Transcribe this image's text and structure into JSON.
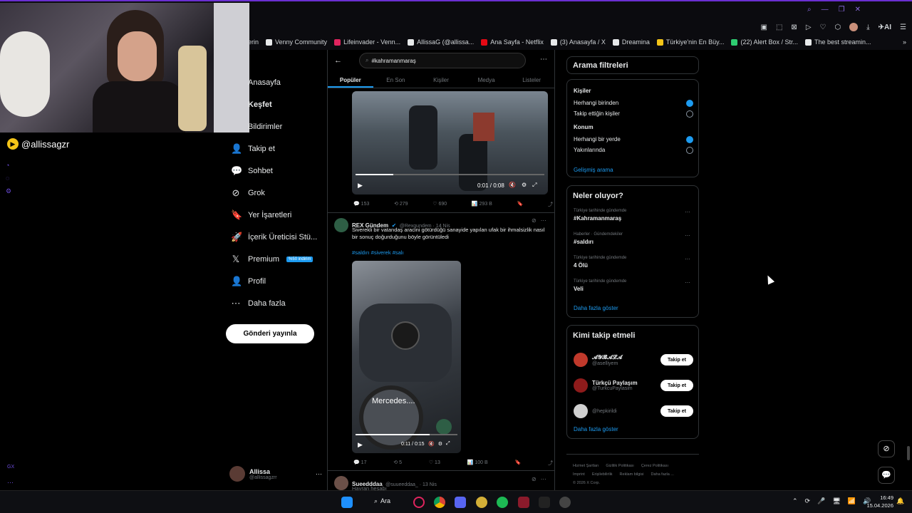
{
  "browser": {
    "bookmarks": [
      {
        "label": "erin",
        "color": ""
      },
      {
        "label": "Venny Community",
        "color": "#e7e9ea"
      },
      {
        "label": "Lifeinvader - Venn...",
        "color": "#e0245e"
      },
      {
        "label": "AllissaG (@allissa...",
        "color": "#e7e9ea"
      },
      {
        "label": "Ana Sayfa - Netflix",
        "color": "#e50914"
      },
      {
        "label": "(3) Anasayfa / X",
        "color": "#e7e9ea"
      },
      {
        "label": "Dreamina",
        "color": "#e7e9ea"
      },
      {
        "label": "Türkiye'nin En Büy...",
        "color": "#f5c518"
      },
      {
        "label": "(22) Alert Box / Str...",
        "color": "#2ecc71"
      },
      {
        "label": "The best streamin...",
        "color": "#e7e9ea"
      }
    ],
    "ai_label": "AI"
  },
  "webcam": {
    "label": "@allissagzr"
  },
  "gx_label": "GX",
  "nav": {
    "items": [
      {
        "label": "Anasayfa",
        "icon": "home-icon",
        "glyph": ""
      },
      {
        "label": "Keşfet",
        "icon": "search-icon",
        "glyph": ""
      },
      {
        "label": "Bildirimler",
        "icon": "bell-icon",
        "glyph": ""
      },
      {
        "label": "Takip et",
        "icon": "person-add-icon",
        "glyph": "👤"
      },
      {
        "label": "Sohbet",
        "icon": "chat-icon",
        "glyph": "💬"
      },
      {
        "label": "Grok",
        "icon": "grok-icon",
        "glyph": "⊘"
      },
      {
        "label": "Yer İşaretleri",
        "icon": "bookmark-icon",
        "glyph": "🔖"
      },
      {
        "label": "İçerik Üreticisi Stü...",
        "icon": "rocket-icon",
        "glyph": "🚀"
      },
      {
        "label": "Premium",
        "icon": "x-logo-icon",
        "glyph": "𝕏"
      },
      {
        "label": "Profil",
        "icon": "profile-icon",
        "glyph": "👤"
      },
      {
        "label": "Daha fazla",
        "icon": "more-icon",
        "glyph": "⋯"
      }
    ],
    "premium_badge": "%50 indirim",
    "post_button": "Gönderi yayınla",
    "account_name": "Allissa",
    "account_handle": "@allissagzrr"
  },
  "search": {
    "query": "#kahramanmaraş"
  },
  "tabs": [
    "Popüler",
    "En Son",
    "Kişiler",
    "Medya",
    "Listeler"
  ],
  "tweet1": {
    "time": "0:01 / 0:08",
    "replies": "153",
    "retweets": "279",
    "likes": "690",
    "views": "293 B"
  },
  "tweet2": {
    "name": "REX Gündem",
    "handle": "@Rexgundem · 14 Nis",
    "text": "Siverekli bir vatandaş aracini götürdüğü sanayide  yapılan ufak bir ihmalsizlik nasıl bir sonuç doğurduğunu böyle görüntüledi",
    "hashtags": "#saldırı #siverek #salı",
    "video_caption": "Mercedes....",
    "time": "0:11 / 0:15",
    "replies": "17",
    "retweets": "5",
    "likes": "13",
    "views": "100 B"
  },
  "tweet3": {
    "name": "Sueedddaa",
    "handle": "@suueeddaa_ · 13 Nis",
    "text": "Hayran hesabı"
  },
  "filters": {
    "title": "Arama filtreleri",
    "people_heading": "Kişiler",
    "people_options": [
      "Herhangi birinden",
      "Takip ettiğin kişiler"
    ],
    "location_heading": "Konum",
    "location_options": [
      "Herhangi bir yerde",
      "Yakınlarında"
    ],
    "advanced": "Gelişmiş arama"
  },
  "trends": {
    "title": "Neler oluyor?",
    "items": [
      {
        "context": "Türkiye tarihinde gündemde",
        "name": "#Kahramanmaraş"
      },
      {
        "context": "Haberler · Gündemdekiler",
        "name": "#saldırı"
      },
      {
        "context": "Türkiye tarihinde gündemde",
        "name": "4 Ölü"
      },
      {
        "context": "Türkiye tarihinde gündemde",
        "name": "Veli"
      }
    ],
    "more": "Daha fazla göster"
  },
  "who_to_follow": {
    "title": "Kimi takip etmeli",
    "accounts": [
      {
        "name": "𝓐𝓨𝓑𝓐𝓛𝓐",
        "handle": "@aselliyem",
        "color": "#c0392b"
      },
      {
        "name": "Türkçü Paylaşım",
        "handle": "@TurkcuPaylasim",
        "color": "#8e1b1b"
      },
      {
        "name": "",
        "handle": "@hepkirildi",
        "color": "#d0d0d0"
      }
    ],
    "follow_label": "Takip et",
    "more": "Daha fazla göster"
  },
  "footer": {
    "links": [
      "Hizmet Şartları",
      "Gizlilik Politikası",
      "Çerez Politikası",
      "Imprint",
      "Erişilebilirlik",
      "Reklam bilgisi",
      "Daha fazla ..."
    ],
    "copyright": "© 2026 X Corp."
  },
  "taskbar": {
    "search_label": "Ara",
    "time": "16:49",
    "date": "15.04.2026"
  }
}
